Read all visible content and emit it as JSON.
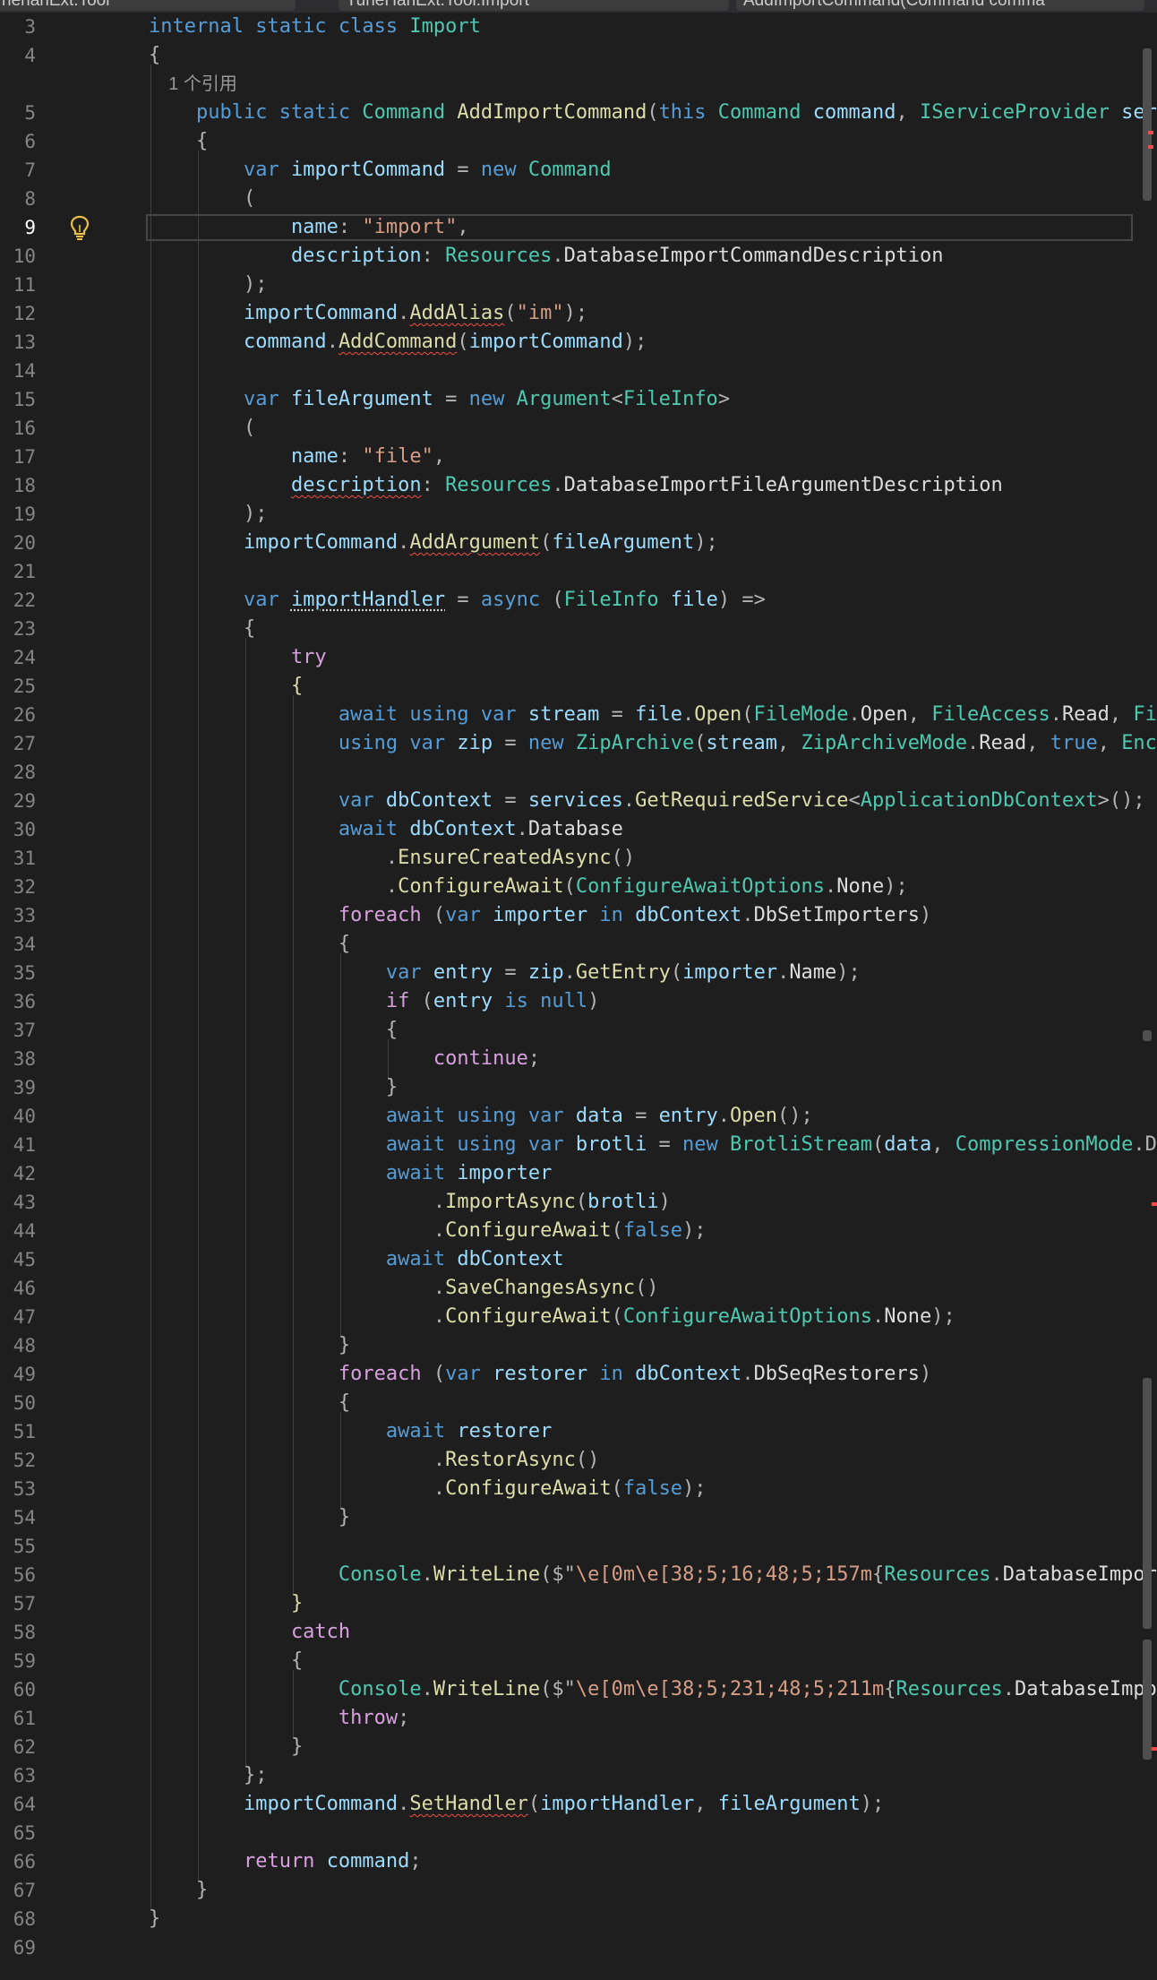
{
  "tabs": [
    {
      "label": "henanExt.Tool"
    },
    {
      "label": "YuheHanExt.Tool.Import"
    },
    {
      "label": "AddImportCommand(Command comma"
    }
  ],
  "codelens": "1 个引用",
  "active_line": 9,
  "colors": {
    "background": "#1e1e1e",
    "keyword": "#569cd6",
    "control_keyword": "#d8a0df",
    "type": "#4ec9b0",
    "method": "#dcdcaa",
    "string": "#d69d85",
    "variable": "#9cdcfe",
    "line_number": "#858585",
    "error_squiggle": "#f14c4c"
  },
  "lines": [
    {
      "n": "3",
      "t": [
        [
          "internal static class ",
          "kw"
        ],
        [
          "Import",
          "ty"
        ]
      ]
    },
    {
      "n": "4",
      "t": [
        [
          "{",
          "pl"
        ]
      ]
    },
    {
      "n": "",
      "t": []
    },
    {
      "n": "5",
      "t": [
        [
          "    public static ",
          "kw"
        ],
        [
          "Command ",
          "ty"
        ],
        [
          "AddImportCommand",
          "fn"
        ],
        [
          "(",
          "pl"
        ],
        [
          "this ",
          "kw"
        ],
        [
          "Command ",
          "ty"
        ],
        [
          "command",
          "var"
        ],
        [
          ", ",
          "pl"
        ],
        [
          "IServiceProvider ",
          "ty"
        ],
        [
          "ser",
          "var"
        ]
      ]
    },
    {
      "n": "6",
      "t": [
        [
          "    {",
          "pl"
        ]
      ]
    },
    {
      "n": "7",
      "t": [
        [
          "        var ",
          "kw"
        ],
        [
          "importCommand ",
          "var"
        ],
        [
          "= ",
          "pl"
        ],
        [
          "new ",
          "kw"
        ],
        [
          "Command",
          "ty"
        ]
      ]
    },
    {
      "n": "8",
      "t": [
        [
          "        (",
          "pl"
        ]
      ]
    },
    {
      "n": "9",
      "t": [
        [
          "            name",
          "var"
        ],
        [
          ": ",
          "pl"
        ],
        [
          "\"import\"",
          "str"
        ],
        [
          ",",
          "pl"
        ]
      ]
    },
    {
      "n": "10",
      "t": [
        [
          "            description",
          "var"
        ],
        [
          ": ",
          "pl"
        ],
        [
          "Resources",
          "ty"
        ],
        [
          ".",
          "pl"
        ],
        [
          "DatabaseImportCommandDescription",
          "pr"
        ]
      ]
    },
    {
      "n": "11",
      "t": [
        [
          "        );",
          "pl"
        ]
      ]
    },
    {
      "n": "12",
      "t": [
        [
          "        importCommand",
          "var"
        ],
        [
          ".",
          "pl"
        ],
        [
          "AddAlias",
          "fnw"
        ],
        [
          "(",
          "pl"
        ],
        [
          "\"im\"",
          "str"
        ],
        [
          ");",
          "pl"
        ]
      ]
    },
    {
      "n": "13",
      "t": [
        [
          "        command",
          "var"
        ],
        [
          ".",
          "pl"
        ],
        [
          "AddCommand",
          "fnw"
        ],
        [
          "(",
          "pl"
        ],
        [
          "importCommand",
          "var"
        ],
        [
          ");",
          "pl"
        ]
      ]
    },
    {
      "n": "14",
      "t": []
    },
    {
      "n": "15",
      "t": [
        [
          "        var ",
          "kw"
        ],
        [
          "fileArgument ",
          "var"
        ],
        [
          "= ",
          "pl"
        ],
        [
          "new ",
          "kw"
        ],
        [
          "Argument",
          "ty"
        ],
        [
          "<",
          "pl"
        ],
        [
          "FileInfo",
          "ty"
        ],
        [
          ">",
          "pl"
        ]
      ]
    },
    {
      "n": "16",
      "t": [
        [
          "        (",
          "pl"
        ]
      ]
    },
    {
      "n": "17",
      "t": [
        [
          "            name",
          "var"
        ],
        [
          ": ",
          "pl"
        ],
        [
          "\"file\"",
          "str"
        ],
        [
          ",",
          "pl"
        ]
      ]
    },
    {
      "n": "18",
      "t": [
        [
          "            ",
          "pl"
        ],
        [
          "description",
          "varw"
        ],
        [
          ": ",
          "pl"
        ],
        [
          "Resources",
          "ty"
        ],
        [
          ".",
          "pl"
        ],
        [
          "DatabaseImportFileArgumentDescription",
          "pr"
        ]
      ]
    },
    {
      "n": "19",
      "t": [
        [
          "        );",
          "pl"
        ]
      ]
    },
    {
      "n": "20",
      "t": [
        [
          "        importCommand",
          "var"
        ],
        [
          ".",
          "pl"
        ],
        [
          "AddArgument",
          "fnw"
        ],
        [
          "(",
          "pl"
        ],
        [
          "fileArgument",
          "var"
        ],
        [
          ");",
          "pl"
        ]
      ]
    },
    {
      "n": "21",
      "t": []
    },
    {
      "n": "22",
      "t": [
        [
          "        var ",
          "kw"
        ],
        [
          "importHandler",
          "vard"
        ],
        [
          " = ",
          "pl"
        ],
        [
          "async ",
          "kw"
        ],
        [
          "(",
          "pl"
        ],
        [
          "FileInfo ",
          "ty"
        ],
        [
          "file",
          "var"
        ],
        [
          ") =>",
          "pl"
        ]
      ]
    },
    {
      "n": "23",
      "t": [
        [
          "        {",
          "pl"
        ]
      ]
    },
    {
      "n": "24",
      "t": [
        [
          "            try",
          "ctl"
        ]
      ]
    },
    {
      "n": "25",
      "t": [
        [
          "            {",
          "fn"
        ]
      ]
    },
    {
      "n": "26",
      "t": [
        [
          "                await using var ",
          "kw"
        ],
        [
          "stream ",
          "var"
        ],
        [
          "= ",
          "pl"
        ],
        [
          "file",
          "var"
        ],
        [
          ".",
          "pl"
        ],
        [
          "Open",
          "fn"
        ],
        [
          "(",
          "pl"
        ],
        [
          "FileMode",
          "ty"
        ],
        [
          ".",
          "pl"
        ],
        [
          "Open",
          "pr"
        ],
        [
          ", ",
          "pl"
        ],
        [
          "FileAccess",
          "ty"
        ],
        [
          ".",
          "pl"
        ],
        [
          "Read",
          "pr"
        ],
        [
          ", ",
          "pl"
        ],
        [
          "Fi",
          "ty"
        ]
      ]
    },
    {
      "n": "27",
      "t": [
        [
          "                using var ",
          "kw"
        ],
        [
          "zip ",
          "var"
        ],
        [
          "= ",
          "pl"
        ],
        [
          "new ",
          "kw"
        ],
        [
          "ZipArchive",
          "ty"
        ],
        [
          "(",
          "pl"
        ],
        [
          "stream",
          "var"
        ],
        [
          ", ",
          "pl"
        ],
        [
          "ZipArchiveMode",
          "ty"
        ],
        [
          ".",
          "pl"
        ],
        [
          "Read",
          "pr"
        ],
        [
          ", ",
          "pl"
        ],
        [
          "true",
          "kw"
        ],
        [
          ", ",
          "pl"
        ],
        [
          "Enc",
          "ty"
        ]
      ]
    },
    {
      "n": "28",
      "t": []
    },
    {
      "n": "29",
      "t": [
        [
          "                var ",
          "kw"
        ],
        [
          "dbContext ",
          "var"
        ],
        [
          "= ",
          "pl"
        ],
        [
          "services",
          "var"
        ],
        [
          ".",
          "pl"
        ],
        [
          "GetRequiredService",
          "fn"
        ],
        [
          "<",
          "pl"
        ],
        [
          "ApplicationDbContext",
          "ty"
        ],
        [
          ">();",
          "pl"
        ]
      ]
    },
    {
      "n": "30",
      "t": [
        [
          "                await ",
          "kw"
        ],
        [
          "dbContext",
          "var"
        ],
        [
          ".",
          "pl"
        ],
        [
          "Database",
          "pr"
        ]
      ]
    },
    {
      "n": "31",
      "t": [
        [
          "                    .",
          "pl"
        ],
        [
          "EnsureCreatedAsync",
          "fn"
        ],
        [
          "()",
          "pl"
        ]
      ]
    },
    {
      "n": "32",
      "t": [
        [
          "                    .",
          "pl"
        ],
        [
          "ConfigureAwait",
          "fn"
        ],
        [
          "(",
          "pl"
        ],
        [
          "ConfigureAwaitOptions",
          "ty"
        ],
        [
          ".",
          "pl"
        ],
        [
          "None",
          "pr"
        ],
        [
          ");",
          "pl"
        ]
      ]
    },
    {
      "n": "33",
      "t": [
        [
          "                foreach ",
          "ctl"
        ],
        [
          "(",
          "pl"
        ],
        [
          "var ",
          "kw"
        ],
        [
          "importer ",
          "var"
        ],
        [
          "in ",
          "kw"
        ],
        [
          "dbContext",
          "var"
        ],
        [
          ".",
          "pl"
        ],
        [
          "DbSetImporters",
          "pr"
        ],
        [
          ")",
          "pl"
        ]
      ]
    },
    {
      "n": "34",
      "t": [
        [
          "                {",
          "pl"
        ]
      ]
    },
    {
      "n": "35",
      "t": [
        [
          "                    var ",
          "kw"
        ],
        [
          "entry ",
          "var"
        ],
        [
          "= ",
          "pl"
        ],
        [
          "zip",
          "var"
        ],
        [
          ".",
          "pl"
        ],
        [
          "GetEntry",
          "fn"
        ],
        [
          "(",
          "pl"
        ],
        [
          "importer",
          "var"
        ],
        [
          ".",
          "pl"
        ],
        [
          "Name",
          "pr"
        ],
        [
          ");",
          "pl"
        ]
      ]
    },
    {
      "n": "36",
      "t": [
        [
          "                    if ",
          "ctl"
        ],
        [
          "(",
          "pl"
        ],
        [
          "entry ",
          "var"
        ],
        [
          "is null",
          "kw"
        ],
        [
          ")",
          "pl"
        ]
      ]
    },
    {
      "n": "37",
      "t": [
        [
          "                    {",
          "pl"
        ]
      ]
    },
    {
      "n": "38",
      "t": [
        [
          "                        continue",
          "ctl"
        ],
        [
          ";",
          "pl"
        ]
      ]
    },
    {
      "n": "39",
      "t": [
        [
          "                    }",
          "pl"
        ]
      ]
    },
    {
      "n": "40",
      "t": [
        [
          "                    await using var ",
          "kw"
        ],
        [
          "data ",
          "var"
        ],
        [
          "= ",
          "pl"
        ],
        [
          "entry",
          "var"
        ],
        [
          ".",
          "pl"
        ],
        [
          "Open",
          "fn"
        ],
        [
          "();",
          "pl"
        ]
      ]
    },
    {
      "n": "41",
      "t": [
        [
          "                    await using var ",
          "kw"
        ],
        [
          "brotli ",
          "var"
        ],
        [
          "= ",
          "pl"
        ],
        [
          "new ",
          "kw"
        ],
        [
          "BrotliStream",
          "ty"
        ],
        [
          "(",
          "pl"
        ],
        [
          "data",
          "var"
        ],
        [
          ", ",
          "pl"
        ],
        [
          "CompressionMode",
          "ty"
        ],
        [
          ".D",
          "pl"
        ]
      ]
    },
    {
      "n": "42",
      "t": [
        [
          "                    await ",
          "kw"
        ],
        [
          "importer",
          "var"
        ]
      ]
    },
    {
      "n": "43",
      "t": [
        [
          "                        .",
          "pl"
        ],
        [
          "ImportAsync",
          "fn"
        ],
        [
          "(",
          "pl"
        ],
        [
          "brotli",
          "var"
        ],
        [
          ")",
          "pl"
        ]
      ]
    },
    {
      "n": "44",
      "t": [
        [
          "                        .",
          "pl"
        ],
        [
          "ConfigureAwait",
          "fn"
        ],
        [
          "(",
          "pl"
        ],
        [
          "false",
          "kw"
        ],
        [
          ");",
          "pl"
        ]
      ]
    },
    {
      "n": "45",
      "t": [
        [
          "                    await ",
          "kw"
        ],
        [
          "dbContext",
          "var"
        ]
      ]
    },
    {
      "n": "46",
      "t": [
        [
          "                        .",
          "pl"
        ],
        [
          "SaveChangesAsync",
          "fn"
        ],
        [
          "()",
          "pl"
        ]
      ]
    },
    {
      "n": "47",
      "t": [
        [
          "                        .",
          "pl"
        ],
        [
          "ConfigureAwait",
          "fn"
        ],
        [
          "(",
          "pl"
        ],
        [
          "ConfigureAwaitOptions",
          "ty"
        ],
        [
          ".",
          "pl"
        ],
        [
          "None",
          "pr"
        ],
        [
          ");",
          "pl"
        ]
      ]
    },
    {
      "n": "48",
      "t": [
        [
          "                }",
          "pl"
        ]
      ]
    },
    {
      "n": "49",
      "t": [
        [
          "                foreach ",
          "ctl"
        ],
        [
          "(",
          "pl"
        ],
        [
          "var ",
          "kw"
        ],
        [
          "restorer ",
          "var"
        ],
        [
          "in ",
          "kw"
        ],
        [
          "dbContext",
          "var"
        ],
        [
          ".",
          "pl"
        ],
        [
          "DbSeqRestorers",
          "pr"
        ],
        [
          ")",
          "pl"
        ]
      ]
    },
    {
      "n": "50",
      "t": [
        [
          "                {",
          "pl"
        ]
      ]
    },
    {
      "n": "51",
      "t": [
        [
          "                    await ",
          "kw"
        ],
        [
          "restorer",
          "var"
        ]
      ]
    },
    {
      "n": "52",
      "t": [
        [
          "                        .",
          "pl"
        ],
        [
          "RestorAsync",
          "fn"
        ],
        [
          "()",
          "pl"
        ]
      ]
    },
    {
      "n": "53",
      "t": [
        [
          "                        .",
          "pl"
        ],
        [
          "ConfigureAwait",
          "fn"
        ],
        [
          "(",
          "pl"
        ],
        [
          "false",
          "kw"
        ],
        [
          ");",
          "pl"
        ]
      ]
    },
    {
      "n": "54",
      "t": [
        [
          "                }",
          "pl"
        ]
      ]
    },
    {
      "n": "55",
      "t": []
    },
    {
      "n": "56",
      "t": [
        [
          "                Console",
          "ty"
        ],
        [
          ".",
          "pl"
        ],
        [
          "WriteLine",
          "fn"
        ],
        [
          "($\"",
          "pl"
        ],
        [
          "\\e[0m\\e[38;5;16;48;5;157m",
          "str"
        ],
        [
          "{",
          "pl"
        ],
        [
          "Resources",
          "ty"
        ],
        [
          ".",
          "pl"
        ],
        [
          "DatabaseImpor",
          "pr"
        ]
      ]
    },
    {
      "n": "57",
      "t": [
        [
          "            }",
          "fn"
        ]
      ]
    },
    {
      "n": "58",
      "t": [
        [
          "            catch",
          "ctl"
        ]
      ]
    },
    {
      "n": "59",
      "t": [
        [
          "            {",
          "pl"
        ]
      ]
    },
    {
      "n": "60",
      "t": [
        [
          "                Console",
          "ty"
        ],
        [
          ".",
          "pl"
        ],
        [
          "WriteLine",
          "fn"
        ],
        [
          "($\"",
          "pl"
        ],
        [
          "\\e[0m\\e[38;5;231;48;5;211m",
          "str"
        ],
        [
          "{",
          "pl"
        ],
        [
          "Resources",
          "ty"
        ],
        [
          ".",
          "pl"
        ],
        [
          "DatabaseImpo",
          "pr"
        ]
      ]
    },
    {
      "n": "61",
      "t": [
        [
          "                throw",
          "ctl"
        ],
        [
          ";",
          "pl"
        ]
      ]
    },
    {
      "n": "62",
      "t": [
        [
          "            }",
          "pl"
        ]
      ]
    },
    {
      "n": "63",
      "t": [
        [
          "        };",
          "pl"
        ]
      ]
    },
    {
      "n": "64",
      "t": [
        [
          "        importCommand",
          "var"
        ],
        [
          ".",
          "pl"
        ],
        [
          "SetHandler",
          "fnw"
        ],
        [
          "(",
          "pl"
        ],
        [
          "importHandler",
          "var"
        ],
        [
          ", ",
          "pl"
        ],
        [
          "fileArgument",
          "var"
        ],
        [
          ");",
          "pl"
        ]
      ]
    },
    {
      "n": "65",
      "t": []
    },
    {
      "n": "66",
      "t": [
        [
          "        return ",
          "ctl"
        ],
        [
          "command",
          "var"
        ],
        [
          ";",
          "pl"
        ]
      ]
    },
    {
      "n": "67",
      "t": [
        [
          "    }",
          "pl"
        ]
      ]
    },
    {
      "n": "68",
      "t": [
        [
          "}",
          "pl"
        ]
      ]
    },
    {
      "n": "69",
      "t": []
    }
  ]
}
